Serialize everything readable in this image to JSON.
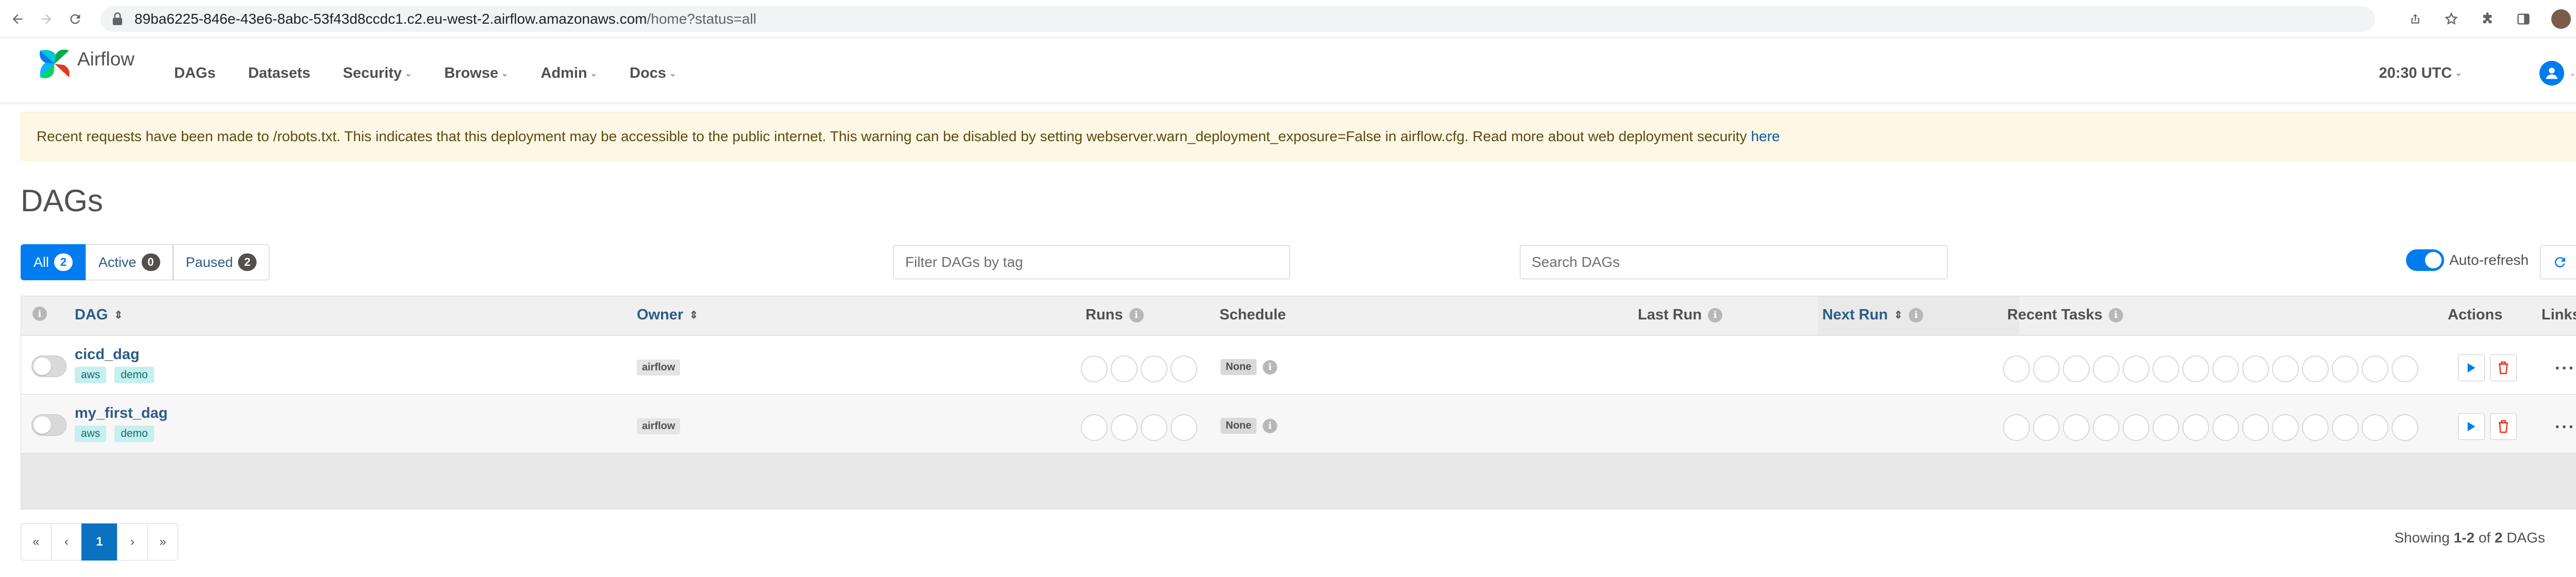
{
  "browser": {
    "url_host": "89ba6225-846e-43e6-8abc-53f43d8ccdc1.c2.eu-west-2.airflow.amazonaws.com",
    "url_path": "/home?status=all"
  },
  "navbar": {
    "brand": "Airflow",
    "items": [
      {
        "label": "DAGs",
        "dropdown": false
      },
      {
        "label": "Datasets",
        "dropdown": false
      },
      {
        "label": "Security",
        "dropdown": true
      },
      {
        "label": "Browse",
        "dropdown": true
      },
      {
        "label": "Admin",
        "dropdown": true
      },
      {
        "label": "Docs",
        "dropdown": true
      }
    ],
    "time": "20:30 UTC"
  },
  "alert": {
    "text": "Recent requests have been made to /robots.txt. This indicates that this deployment may be accessible to the public internet. This warning can be disabled by setting webserver.warn_deployment_exposure=False in airflow.cfg. Read more about web deployment security",
    "link": "here",
    "close": "×"
  },
  "page": {
    "title": "DAGs"
  },
  "filters": {
    "all_label": "All",
    "all_count": "2",
    "active_label": "Active",
    "active_count": "0",
    "paused_label": "Paused",
    "paused_count": "2",
    "tag_placeholder": "Filter DAGs by tag",
    "search_placeholder": "Search DAGs",
    "autorefresh_label": "Auto-refresh"
  },
  "table": {
    "headers": {
      "dag": "DAG",
      "owner": "Owner",
      "runs": "Runs",
      "schedule": "Schedule",
      "last_run": "Last Run",
      "next_run": "Next Run",
      "recent_tasks": "Recent Tasks",
      "actions": "Actions",
      "links": "Links"
    },
    "rows": [
      {
        "dag_id": "cicd_dag",
        "tags": [
          "aws",
          "demo"
        ],
        "owner": "airflow",
        "schedule": "None"
      },
      {
        "dag_id": "my_first_dag",
        "tags": [
          "aws",
          "demo"
        ],
        "owner": "airflow",
        "schedule": "None"
      }
    ]
  },
  "pagination": {
    "first": "«",
    "prev": "‹",
    "current": "1",
    "next": "›",
    "last": "»",
    "showing_prefix": "Showing",
    "showing_range": "1-2",
    "showing_of": "of",
    "showing_total": "2",
    "showing_suffix": "DAGs"
  },
  "colors": {
    "accent": "#017cee",
    "link": "#2e5b87",
    "alert_bg": "#fcf8e3",
    "delete": "#e43921",
    "tag_bg": "#c5f0ef"
  }
}
